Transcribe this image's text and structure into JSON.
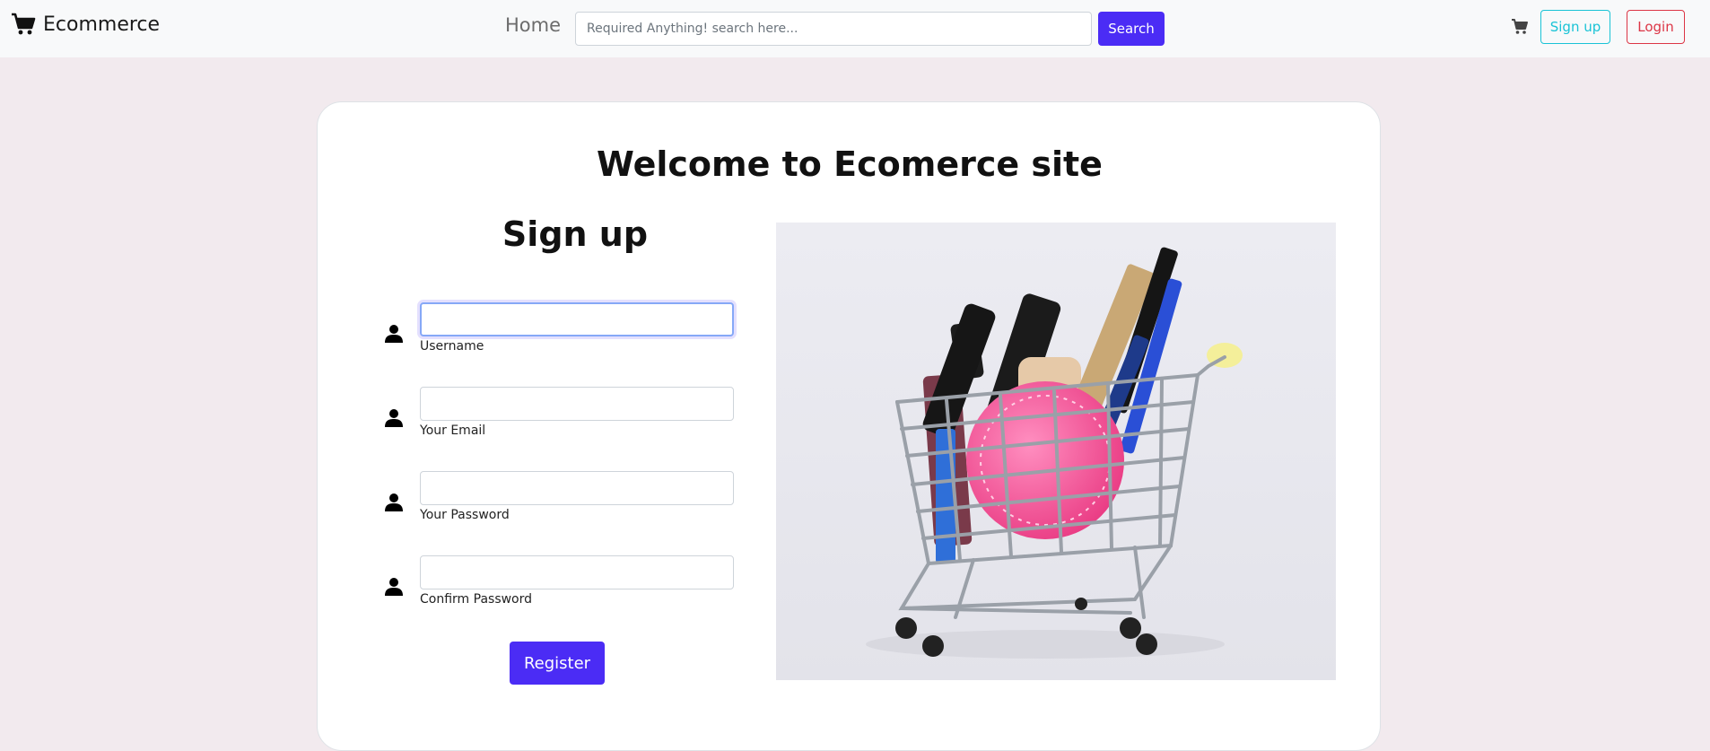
{
  "nav": {
    "brand": "Ecommerce",
    "home": "Home",
    "search_placeholder": "Required Anything! search here...",
    "search_button": "Search",
    "signup": "Sign up",
    "login": "Login"
  },
  "page": {
    "welcome": "Welcome to Ecomerce site",
    "signup_title": "Sign up",
    "fields": [
      {
        "label": "Username",
        "value": ""
      },
      {
        "label": "Your Email",
        "value": ""
      },
      {
        "label": "Your Password",
        "value": ""
      },
      {
        "label": "Confirm Password",
        "value": ""
      }
    ],
    "register_button": "Register"
  },
  "colors": {
    "primary": "#4b2cf5",
    "info": "#19c3d6",
    "danger": "#dc3545",
    "page_bg": "#f2eaee"
  },
  "icons": {
    "brand": "shopping-cart-icon",
    "cart": "cart-icon",
    "field": "user-icon"
  }
}
